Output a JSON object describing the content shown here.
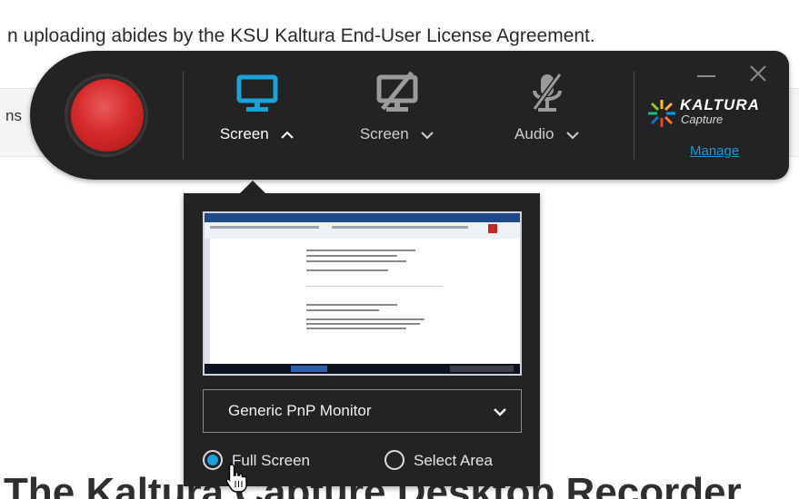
{
  "page": {
    "top_text": "n uploading abides by the KSU Kaltura End-User License Agreement.",
    "band_text": "ns",
    "heading": "The Kaltura Capture Desktop Recorder"
  },
  "toolbar": {
    "record_button": "record",
    "tools": [
      {
        "label": "Screen",
        "icon": "monitor-icon",
        "active": true,
        "chevron": "up"
      },
      {
        "label": "Screen",
        "icon": "monitor-off-icon",
        "active": false,
        "chevron": "down"
      },
      {
        "label": "Audio",
        "icon": "microphone-off-icon",
        "active": false,
        "chevron": "down"
      }
    ],
    "logo_word": "KALTURA",
    "logo_sub": "Capture",
    "manage_label": "Manage",
    "colors": {
      "accent": "#1aa3d9",
      "record": "#d62a2a",
      "background": "#232325"
    }
  },
  "panel": {
    "monitor_selected": "Generic PnP Monitor",
    "options": [
      {
        "label": "Full Screen",
        "selected": true
      },
      {
        "label": "Select Area",
        "selected": false
      }
    ]
  }
}
